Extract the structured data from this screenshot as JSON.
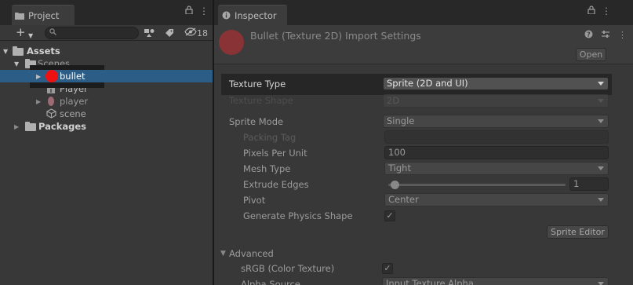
{
  "project": {
    "tab_title": "Project",
    "hidden_count": "18",
    "tree": {
      "assets": "Assets",
      "scenes": "Scenes",
      "bullet": "bullet",
      "player_prefab": "Player",
      "player_sprite": "player",
      "scene": "scene",
      "packages": "Packages"
    }
  },
  "inspector": {
    "tab_title": "Inspector",
    "title": "Bullet (Texture 2D) Import Settings",
    "open_label": "Open",
    "texture_type": {
      "label": "Texture Type",
      "value": "Sprite (2D and UI)"
    },
    "texture_shape": {
      "label": "Texture Shape",
      "value": "2D"
    },
    "sprite_mode": {
      "label": "Sprite Mode",
      "value": "Single"
    },
    "packing_tag": {
      "label": "Packing Tag",
      "value": ""
    },
    "pixels_per_unit": {
      "label": "Pixels Per Unit",
      "value": "100"
    },
    "mesh_type": {
      "label": "Mesh Type",
      "value": "Tight"
    },
    "extrude_edges": {
      "label": "Extrude Edges",
      "value": "1",
      "slider_fraction": 0.0
    },
    "pivot": {
      "label": "Pivot",
      "value": "Center"
    },
    "generate_physics": {
      "label": "Generate Physics Shape",
      "checked": true
    },
    "sprite_editor_label": "Sprite Editor",
    "advanced": {
      "label": "Advanced",
      "srgb": {
        "label": "sRGB (Color Texture)",
        "checked": true
      },
      "alpha_source": {
        "label": "Alpha Source",
        "value": "Input Texture Alpha"
      }
    }
  },
  "colors": {
    "selection": "#2c5d87",
    "highlight_dot": "#ee1111",
    "thumbnail": "#8a3337"
  }
}
